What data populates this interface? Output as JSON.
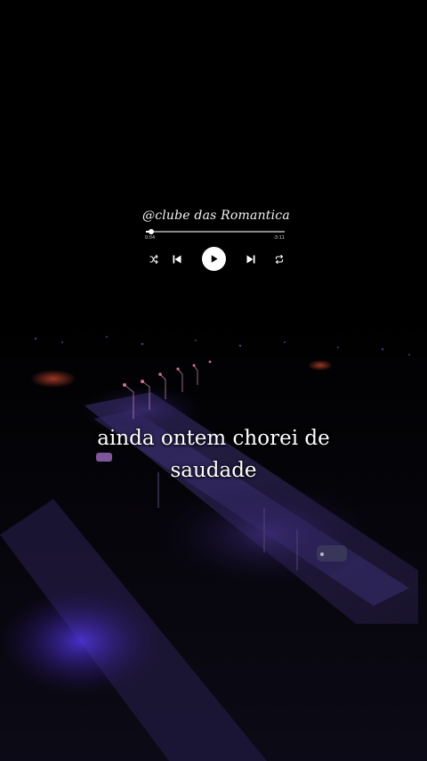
{
  "player": {
    "handle": "@clube das Romantica",
    "progress_fraction": 0.04,
    "time_elapsed": "0:04",
    "time_remaining": "-3:11",
    "controls": {
      "shuffle_icon": "shuffle-icon",
      "previous_icon": "skip-previous-icon",
      "play_icon": "play-icon",
      "next_icon": "skip-next-icon",
      "repeat_icon": "repeat-icon"
    }
  },
  "lyric": {
    "line1": "ainda ontem chorei de",
    "line2": "saudade"
  },
  "colors": {
    "background": "#000000",
    "foreground": "#ffffff",
    "scene_light": "#6a4cff"
  }
}
